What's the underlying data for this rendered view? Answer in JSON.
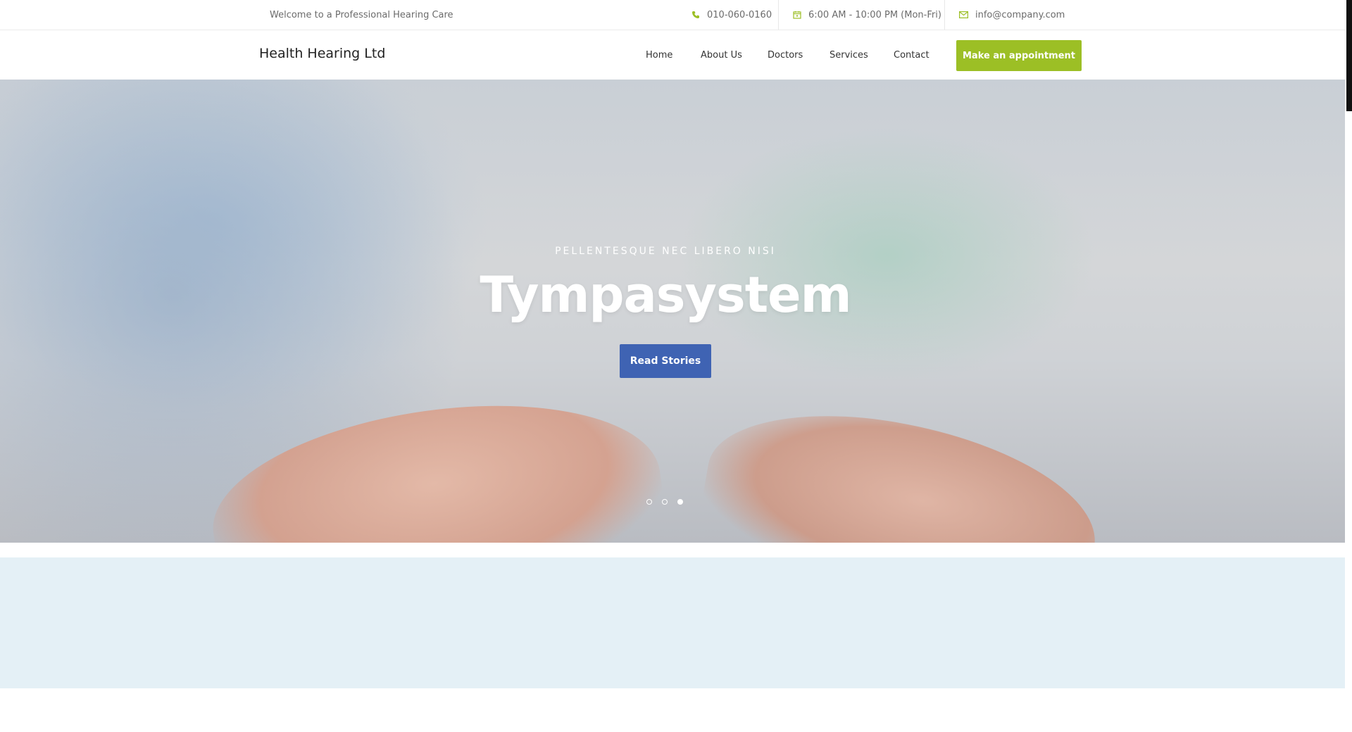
{
  "topbar": {
    "welcome": "Welcome to a Professional Hearing Care",
    "phone": "010-060-0160",
    "hours": "6:00 AM - 10:00 PM (Mon-Fri)",
    "email": "info@company.com"
  },
  "nav": {
    "brand": "Health Hearing Ltd",
    "items": [
      "Home",
      "About Us",
      "Doctors",
      "Services",
      "Contact"
    ],
    "cta": "Make an appointment"
  },
  "hero": {
    "kicker": "PELLENTESQUE NEC LIBERO NISI",
    "title": "Tympasystem",
    "button": "Read Stories",
    "slides_total": 3,
    "active_slide": 3
  },
  "colors": {
    "accent_green": "#9cbf25",
    "button_blue": "#3f63b3",
    "band_bg": "#e4f0f6"
  }
}
